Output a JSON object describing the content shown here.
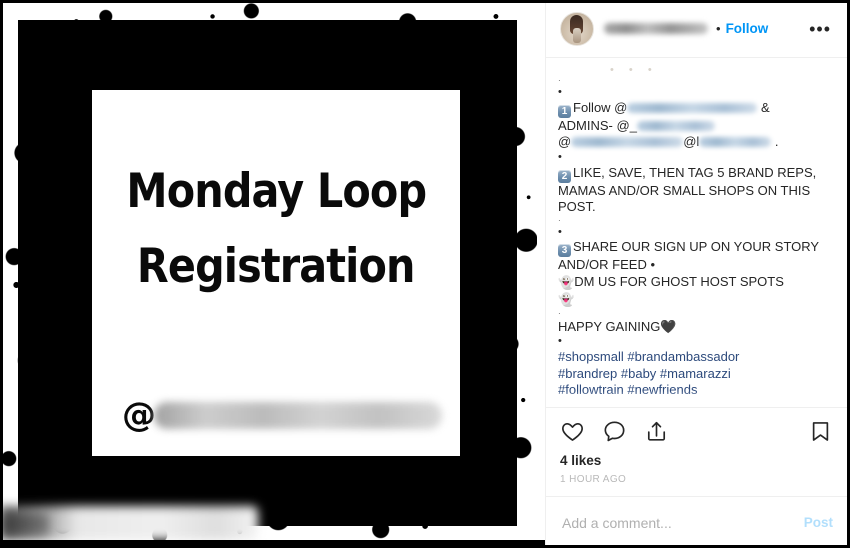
{
  "post": {
    "header": {
      "username_redacted": true,
      "separator": "•",
      "follow_label": "Follow",
      "more_menu_label": "•••"
    },
    "media": {
      "poster_line_1": "Monday Loop",
      "poster_line_2": "Registration",
      "at_symbol": "@",
      "handle_redacted": true
    },
    "caption": {
      "scrolled_off_hint": "• • •",
      "steps": [
        {
          "badge": "1",
          "text_before": "Follow @",
          "mention_redacted_width": 130,
          "text_after": " &",
          "line2_prefix": "ADMINS- @_",
          "line2_redacted_width": 78,
          "line3_prefix": "@",
          "line3_redacted_a": 112,
          "line3_mid": "@l",
          "line3_redacted_b": 72,
          "line3_suffix": " ."
        },
        {
          "badge": "2",
          "text": "LIKE, SAVE, THEN TAG 5 BRAND REPS, MAMAS AND/OR SMALL SHOPS ON THIS POST."
        },
        {
          "badge": "3",
          "text": "SHARE OUR SIGN UP ON YOUR STORY AND/OR FEED •",
          "ghost_line": "DM US FOR GHOST HOST SPOTS",
          "ghost_emoji": "👻"
        }
      ],
      "closing": "HAPPY GAINING",
      "closing_emoji": "🖤",
      "bullet": "•",
      "small_dot": "·",
      "hashtags_line_1": "#shopsmall #brandambassador",
      "hashtags_line_2": "#brandrep #baby #mamarazzi",
      "hashtags_line_3": "#followtrain #newfriends"
    },
    "actions": {
      "like_icon": "heart-icon",
      "comment_icon": "comment-bubble-icon",
      "share_icon": "share-icon",
      "save_icon": "bookmark-icon",
      "likes_count": "4 likes",
      "timestamp": "1 HOUR AGO"
    },
    "comment_composer": {
      "placeholder": "Add a comment...",
      "value": "",
      "post_label": "Post"
    }
  },
  "colors": {
    "link_blue": "#0095f6",
    "hashtag_blue": "#2d4a7c",
    "post_disabled_blue": "#b2dffc",
    "text_primary": "#262626",
    "meta_gray": "#b9b9b9",
    "divider": "#efefef"
  }
}
